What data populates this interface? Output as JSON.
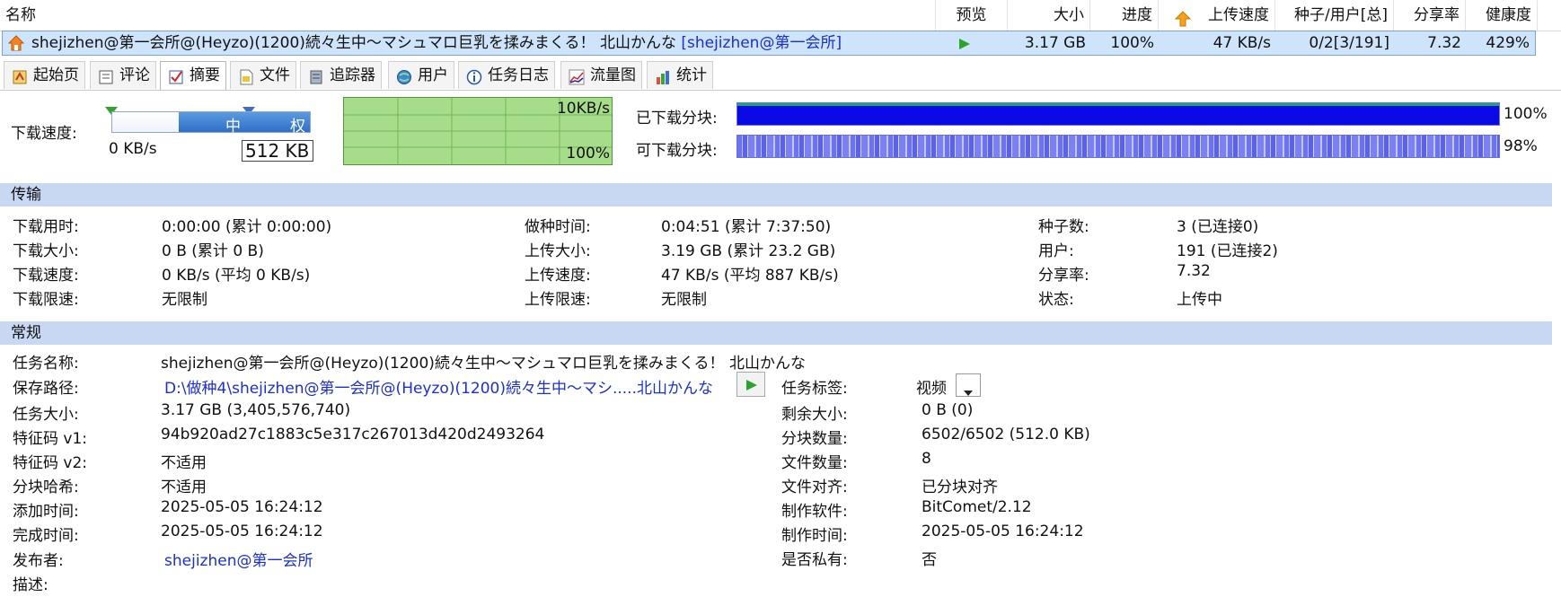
{
  "columns": {
    "name": "名称",
    "preview": "预览",
    "size": "大小",
    "progress": "进度",
    "upload_speed": "上传速度",
    "seeds_peers": "种子/用户[总]",
    "ratio": "分享率",
    "health": "健康度"
  },
  "task_row": {
    "name": "shejizhen@第一会所@(Heyzo)(1200)続々生中～マシュマロ巨乳を揉みまくる！ 北山かんな",
    "name_link": "[shejizhen@第一会所]",
    "size": "3.17 GB",
    "progress": "100%",
    "upload_speed": "47 KB/s",
    "seeds_peers": "0/2[3/191]",
    "ratio": "7.32",
    "health": "429%"
  },
  "tabs": [
    "起始页",
    "评论",
    "摘要",
    "文件",
    "追踪器",
    "用户",
    "任务日志",
    "流量图",
    "统计"
  ],
  "speed_panel": {
    "label": "下载速度:",
    "current": "0 KB/s",
    "limit_value": "512 KB",
    "slider_mid": "中",
    "slider_high": "权",
    "graph_top": "10KB/s",
    "graph_bottom": "100%",
    "downloaded_label": "已下载分块:",
    "downloaded_pct": "100%",
    "downloaded_fraction": 1.0,
    "available_label": "可下载分块:",
    "available_pct": "98%",
    "available_fraction": 0.98
  },
  "transfer": {
    "title": "传输",
    "col1": [
      {
        "label": "下载用时:",
        "value": "0:00:00 (累计 0:00:00)"
      },
      {
        "label": "下载大小:",
        "value": "0 B (累计 0 B)"
      },
      {
        "label": "下载速度:",
        "value": "0 KB/s (平均 0 KB/s)"
      },
      {
        "label": "下载限速:",
        "value": "无限制"
      }
    ],
    "col2": [
      {
        "label": "做种时间:",
        "value": "0:04:51 (累计 7:37:50)"
      },
      {
        "label": "上传大小:",
        "value": "3.19 GB (累计 23.2 GB)"
      },
      {
        "label": "上传速度:",
        "value": "47 KB/s (平均 887 KB/s)"
      },
      {
        "label": "上传限速:",
        "value": "无限制"
      }
    ],
    "col3": [
      {
        "label": "种子数:",
        "value": "3 (已连接0)"
      },
      {
        "label": "用户:",
        "value": "191 (已连接2)"
      },
      {
        "label": "分享率:",
        "value": "7.32"
      },
      {
        "label": "状态:",
        "value": "上传中"
      }
    ]
  },
  "general": {
    "title": "常规",
    "task_name_label": "任务名称:",
    "task_name": "shejizhen@第一会所@(Heyzo)(1200)続々生中～マシュマロ巨乳を揉みまくる！ 北山かんな",
    "save_path_label": "保存路径:",
    "save_path": "D:\\做种4\\shejizhen@第一会所@(Heyzo)(1200)続々生中～マシ.....北山かんな",
    "task_tag_label": "任务标签:",
    "task_tag": "视频",
    "left": [
      {
        "label": "任务大小:",
        "value": "3.17 GB (3,405,576,740)"
      },
      {
        "label": "特征码 v1:",
        "value": "94b920ad27c1883c5e317c267013d420d2493264"
      },
      {
        "label": "特征码 v2:",
        "value": "不适用"
      },
      {
        "label": "分块哈希:",
        "value": "不适用"
      },
      {
        "label": "添加时间:",
        "value": "2025-05-05 16:24:12"
      },
      {
        "label": "完成时间:",
        "value": "2025-05-05 16:24:12"
      }
    ],
    "right": [
      {
        "label": "剩余大小:",
        "value": "0 B (0)"
      },
      {
        "label": "分块数量:",
        "value": "6502/6502 (512.0 KB)"
      },
      {
        "label": "文件数量:",
        "value": "8"
      },
      {
        "label": "文件对齐:",
        "value": "已分块对齐"
      },
      {
        "label": "制作软件:",
        "value": "BitComet/2.12"
      },
      {
        "label": "制作时间:",
        "value": "2025-05-05 16:24:12"
      },
      {
        "label": "是否私有:",
        "value": "否"
      }
    ],
    "publisher_label": "发布者:",
    "publisher": "shejizhen@第一会所",
    "description_label": "描述:"
  }
}
